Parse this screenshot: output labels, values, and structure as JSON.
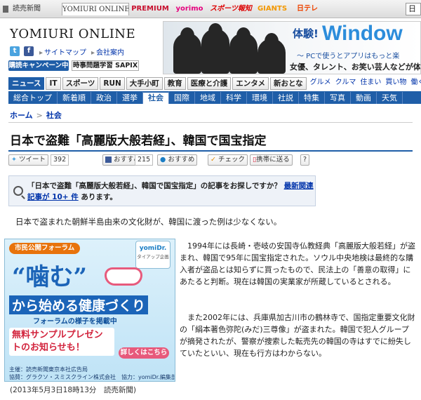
{
  "topbar": {
    "home": "読売新聞",
    "online": "YOMIURI ONLINE",
    "premium": "PREMIUM",
    "yorimo": "yorimo",
    "hochi": "スポーツ報知",
    "giants": "GIANTS",
    "ntv": "日テレ",
    "search": "日"
  },
  "header": {
    "logo": "YOMIURI ONLINE",
    "twitter_glyph": "t",
    "facebook_glyph": "f",
    "links": [
      "サイトマップ",
      "会社案内"
    ],
    "promo1": "購読キャンペーン中",
    "promo2": "時事問題学習 SAPIX"
  },
  "banner_ad": {
    "taiken": "体験!",
    "windows": "Window",
    "line2": "～ PCで使うとアプリはもっと楽",
    "line3": "女優、タレント、お笑い芸人などが体"
  },
  "nav_primary": {
    "tabs": [
      "ニュース",
      "IT",
      "スポーツ",
      "RUN",
      "大手小町",
      "教育",
      "医療と介護",
      "エンタメ",
      "新おとな"
    ],
    "active_tab": "ニュース",
    "extras": [
      "グルメ",
      "クルマ",
      "住まい",
      "買い物",
      "働く"
    ]
  },
  "nav_secondary": {
    "items": [
      "総合トップ",
      "新着順",
      "政治",
      "選挙",
      "社会",
      "国際",
      "地域",
      "科学",
      "環境",
      "社説",
      "特集",
      "写真",
      "動画",
      "天気"
    ],
    "active": "社会"
  },
  "breadcrumb": {
    "home": "ホーム",
    "sep": ">",
    "current": "社会"
  },
  "article": {
    "headline": "日本で盗難「高麗版大般若経」、韓国で国宝指定",
    "lead": "日本で盗まれた朝鮮半島由来の文化財が、韓国に渡った例は少なくない。",
    "para1": "1994年には長崎・壱岐の安国寺仏教経典「高麗版大般若経」が盗まれ、韓国で95年に国宝指定された。ソウル中央地検は最終的な購入者が盗品とは知らずに買ったもので、民法上の「善意の取得」にあたると判断。現在は韓国の実業家が所蔵しているとされる。",
    "para2": "また2002年には、兵庫県加古川市の鶴林寺で、国指定重要文化財の「絹本著色弥陀(みだ)三尊像」が盗まれた。韓国で犯人グループが摘発されたが、警察が捜索した転売先の韓国の寺はすでに紛失していたといい、現在も行方はわからない。",
    "dateline": "(2013年5月3日18時13分　読売新聞)"
  },
  "share": {
    "tweet": "ツイート",
    "tweet_count": "392",
    "hatena": "おすすめ",
    "hatena_count": "215",
    "mixi": "おすすめ",
    "check": "チェック",
    "mobile": "携帯に送る",
    "help": "?"
  },
  "notice": {
    "before": "「日本で盗難「高麗版大般若経」、韓国で国宝指定」の記事をお探しですか？",
    "link": "最新関連記事が 10+ 件",
    "after": "あります。"
  },
  "side_ad": {
    "forum": "市民公開フォーラム",
    "brand": "yomiDr.",
    "brand_sub": "タイアップ企画",
    "kamu": "“噛む”",
    "title": "から始める健康づくり",
    "sub": "フォーラムの様子を掲載中",
    "free": "無料サンプルプレゼントのお知らせも！",
    "button": "詳しくはこちら",
    "credit1": "主催：読売新聞東京本社広告局",
    "credit2": "協賛：グラクソ・スミスクライン株式会社　協力：yomiDr.編集部"
  }
}
